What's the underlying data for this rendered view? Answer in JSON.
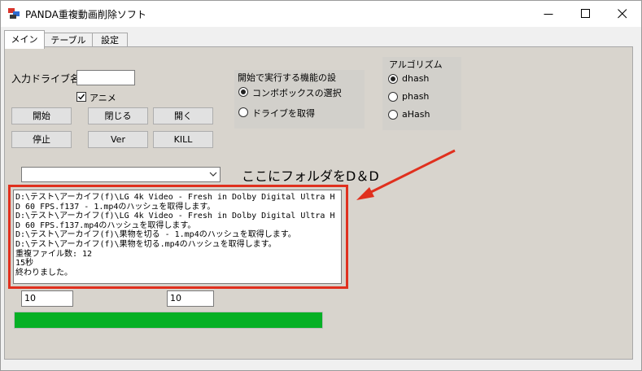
{
  "window": {
    "title": "PANDA重複動画削除ソフト"
  },
  "tabs": [
    {
      "label": "メイン",
      "active": true
    },
    {
      "label": "テーブル",
      "active": false
    },
    {
      "label": "設定",
      "active": false
    }
  ],
  "main": {
    "drive_label": "入力ドライブ名:",
    "drive_value": "",
    "anime_checkbox": {
      "label": "アニメ",
      "checked": true
    },
    "buttons": {
      "start": "開始",
      "close": "閉じる",
      "open": "開く",
      "stop": "停止",
      "ver": "Ver",
      "kill": "KILL"
    },
    "function_group": {
      "title": "開始で実行する機能の設",
      "options": [
        {
          "label": "コンボボックスの選択",
          "selected": true
        },
        {
          "label": "ドライブを取得",
          "selected": false
        }
      ]
    },
    "algorithm_group": {
      "title": "アルゴリズム",
      "options": [
        {
          "label": "dhash",
          "selected": true
        },
        {
          "label": "phash",
          "selected": false
        },
        {
          "label": "aHash",
          "selected": false
        }
      ]
    },
    "combo_value": "",
    "drop_hint": "ここにフォルダをD＆D",
    "log_lines": [
      "D:\\テスト\\アーカイフ(f)\\LG 4k Video - Fresh in Dolby Digital Ultra HD 60 FPS.f137 - 1.mp4のハッシュを取得します。",
      "D:\\テスト\\アーカイフ(f)\\LG 4k Video - Fresh in Dolby Digital Ultra HD 60 FPS.f137.mp4のハッシュを取得します。",
      "D:\\テスト\\アーカイフ(f)\\果物を切る - 1.mp4のハッシュを取得します。",
      "D:\\テスト\\アーカイフ(f)\\果物を切る.mp4のハッシュを取得します。",
      "重複ファイル数: 12",
      "15秒",
      "終わりました。"
    ],
    "field_left": "10",
    "field_right": "10",
    "progress": {
      "percent": 100,
      "color": "#06b025"
    }
  },
  "colors": {
    "highlight": "#e0301e",
    "progress": "#06b025"
  }
}
